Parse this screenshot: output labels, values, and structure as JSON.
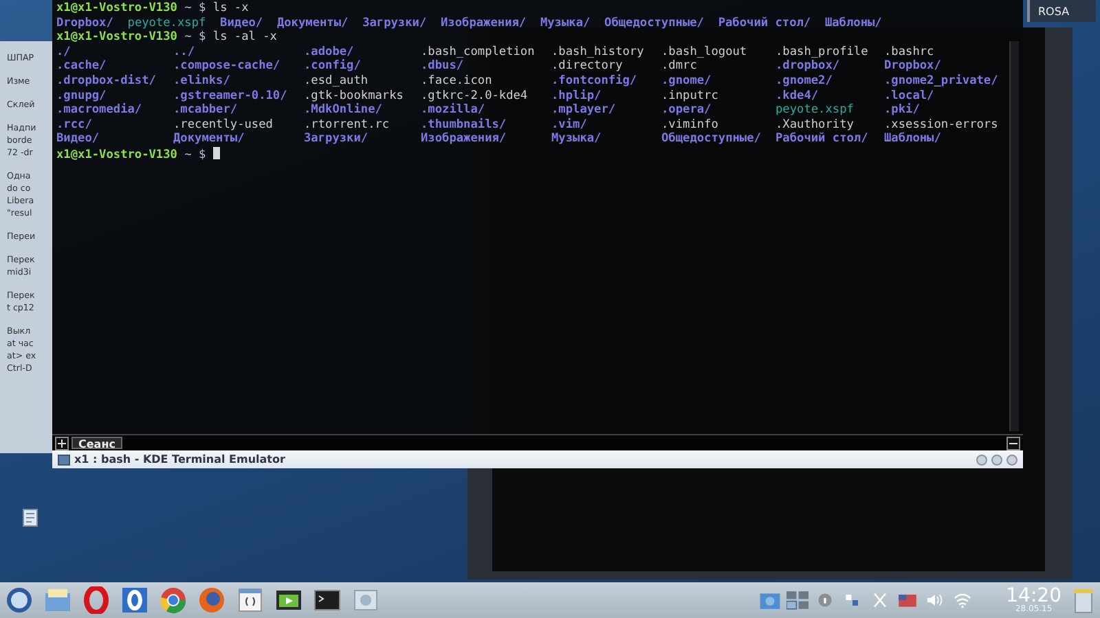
{
  "desktop_widget": {
    "label": "ROSA"
  },
  "background_notes": {
    "paragraphs": [
      [
        "ШПАР"
      ],
      [
        "Изме"
      ],
      [
        "Склей"
      ],
      [
        "Надпи",
        "borde",
        "72 -dr"
      ],
      [
        "Одна",
        "do co",
        "Libera",
        "\"resul"
      ],
      [
        "Переи"
      ],
      [
        "Перек",
        "mid3i"
      ],
      [
        "Перек",
        "t cp12"
      ],
      [
        "Выкл",
        "at час",
        "at> ex",
        "Ctrl-D"
      ]
    ]
  },
  "terminal": {
    "lines": [
      {
        "kind": "prompt",
        "host": "x1@x1-Vostro-V130",
        "path": "~",
        "symbol": "$",
        "command": "ls -x"
      },
      {
        "kind": "row",
        "entries": [
          {
            "name": "Dropbox/",
            "kind": "dir"
          },
          {
            "name": "peyote.xspf",
            "kind": "media"
          },
          {
            "name": "Видео/",
            "kind": "dir"
          },
          {
            "name": "Документы/",
            "kind": "dir"
          },
          {
            "name": "Загрузки/",
            "kind": "dir"
          },
          {
            "name": "Изображения/",
            "kind": "dir"
          },
          {
            "name": "Музыка/",
            "kind": "dir"
          },
          {
            "name": "Общедоступные/",
            "kind": "dir"
          },
          {
            "name": "Рабочий стол/",
            "kind": "dir"
          },
          {
            "name": "Шаблоны/",
            "kind": "dir"
          }
        ]
      },
      {
        "kind": "prompt",
        "host": "x1@x1-Vostro-V130",
        "path": "~",
        "symbol": "$",
        "command": "ls -al -x"
      },
      {
        "kind": "grid",
        "entries": [
          {
            "name": "./",
            "kind": "dir"
          },
          {
            "name": "../",
            "kind": "dir"
          },
          {
            "name": ".adobe/",
            "kind": "dir"
          },
          {
            "name": ".bash_completion",
            "kind": "file"
          },
          {
            "name": ".bash_history",
            "kind": "file"
          },
          {
            "name": ".bash_logout",
            "kind": "file"
          },
          {
            "name": ".bash_profile",
            "kind": "file"
          },
          {
            "name": ".bashrc",
            "kind": "file"
          },
          {
            "name": ".cache/",
            "kind": "dir"
          },
          {
            "name": ".compose-cache/",
            "kind": "dir"
          },
          {
            "name": ".config/",
            "kind": "dir"
          },
          {
            "name": ".dbus/",
            "kind": "dir"
          },
          {
            "name": ".directory",
            "kind": "file"
          },
          {
            "name": ".dmrc",
            "kind": "file"
          },
          {
            "name": ".dropbox/",
            "kind": "dir"
          },
          {
            "name": "Dropbox/",
            "kind": "dir"
          },
          {
            "name": ".dropbox-dist/",
            "kind": "dir"
          },
          {
            "name": ".elinks/",
            "kind": "dir"
          },
          {
            "name": ".esd_auth",
            "kind": "file"
          },
          {
            "name": ".face.icon",
            "kind": "file"
          },
          {
            "name": ".fontconfig/",
            "kind": "dir"
          },
          {
            "name": ".gnome/",
            "kind": "dir"
          },
          {
            "name": ".gnome2/",
            "kind": "dir"
          },
          {
            "name": ".gnome2_private/",
            "kind": "dir"
          },
          {
            "name": ".gnupg/",
            "kind": "dir"
          },
          {
            "name": ".gstreamer-0.10/",
            "kind": "dir"
          },
          {
            "name": ".gtk-bookmarks",
            "kind": "file"
          },
          {
            "name": ".gtkrc-2.0-kde4",
            "kind": "file"
          },
          {
            "name": ".hplip/",
            "kind": "dir"
          },
          {
            "name": ".inputrc",
            "kind": "file"
          },
          {
            "name": ".kde4/",
            "kind": "dir"
          },
          {
            "name": ".local/",
            "kind": "dir"
          },
          {
            "name": ".macromedia/",
            "kind": "dir"
          },
          {
            "name": ".mcabber/",
            "kind": "dir"
          },
          {
            "name": ".MdkOnline/",
            "kind": "dir"
          },
          {
            "name": ".mozilla/",
            "kind": "dir"
          },
          {
            "name": ".mplayer/",
            "kind": "dir"
          },
          {
            "name": ".opera/",
            "kind": "dir"
          },
          {
            "name": "peyote.xspf",
            "kind": "media"
          },
          {
            "name": ".pki/",
            "kind": "dir"
          },
          {
            "name": ".rcc/",
            "kind": "dir"
          },
          {
            "name": ".recently-used",
            "kind": "file"
          },
          {
            "name": ".rtorrent.rc",
            "kind": "file"
          },
          {
            "name": ".thumbnails/",
            "kind": "dir"
          },
          {
            "name": ".vim/",
            "kind": "dir"
          },
          {
            "name": ".viminfo",
            "kind": "file"
          },
          {
            "name": ".Xauthority",
            "kind": "file"
          },
          {
            "name": ".xsession-errors",
            "kind": "file"
          },
          {
            "name": "Видео/",
            "kind": "dir"
          },
          {
            "name": "Документы/",
            "kind": "dir"
          },
          {
            "name": "Загрузки/",
            "kind": "dir"
          },
          {
            "name": "Изображения/",
            "kind": "dir"
          },
          {
            "name": "Музыка/",
            "kind": "dir"
          },
          {
            "name": "Общедоступные/",
            "kind": "dir"
          },
          {
            "name": "Рабочий стол/",
            "kind": "dir"
          },
          {
            "name": "Шаблоны/",
            "kind": "dir"
          }
        ]
      },
      {
        "kind": "prompt",
        "host": "x1@x1-Vostro-V130",
        "path": "~",
        "symbol": "$",
        "cursor": true
      }
    ]
  },
  "tabs": [
    {
      "label": "Сеанс",
      "selected": true
    }
  ],
  "window": {
    "title": "x1 : bash - KDE Terminal Emulator"
  },
  "taskbar": {
    "clock": {
      "time": "14:20",
      "date": "28.05.15"
    }
  }
}
